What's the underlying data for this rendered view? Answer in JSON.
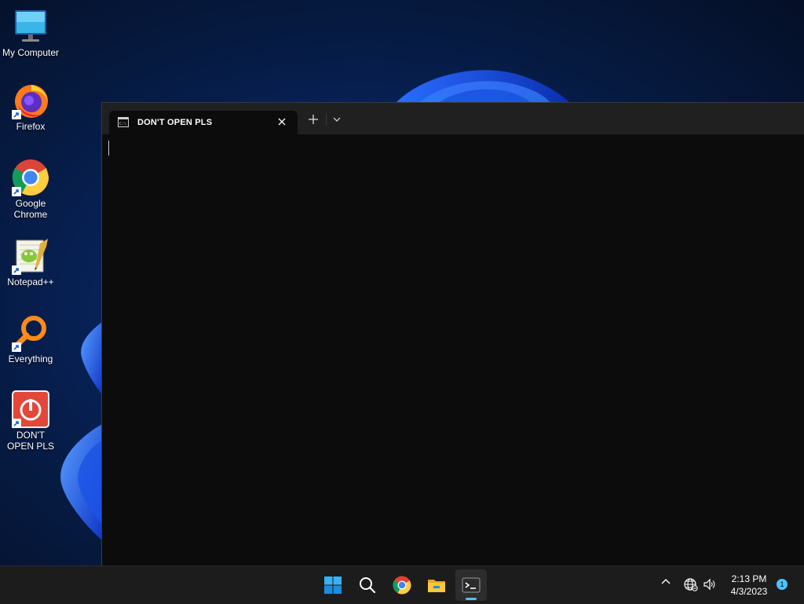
{
  "desktop": {
    "icons": [
      {
        "label": "My Computer",
        "icon": "monitor-icon"
      },
      {
        "label": "Firefox",
        "icon": "firefox-icon"
      },
      {
        "label": "Google Chrome",
        "icon": "chrome-icon"
      },
      {
        "label": "Notepad++",
        "icon": "notepadpp-icon"
      },
      {
        "label": "Everything",
        "icon": "everything-search-icon"
      },
      {
        "label": "DON'T OPEN PLS",
        "icon": "power-icon"
      }
    ]
  },
  "terminal": {
    "tab_title": "DON'T OPEN PLS",
    "tab_icon": "console-icon",
    "close_icon": "close-icon",
    "new_tab_icon": "plus-icon",
    "dropdown_icon": "chevron-down-icon",
    "content": ""
  },
  "taskbar": {
    "apps": [
      {
        "name": "start",
        "icon": "windows-start-icon"
      },
      {
        "name": "search",
        "icon": "search-icon"
      },
      {
        "name": "chrome",
        "icon": "chrome-icon"
      },
      {
        "name": "file-explorer",
        "icon": "folder-icon"
      },
      {
        "name": "terminal",
        "icon": "terminal-icon",
        "active": true
      }
    ],
    "tray": {
      "icons": [
        "chevron-up-icon",
        "network-globe-icon",
        "volume-icon"
      ],
      "time": "2:13 PM",
      "date": "4/3/2023",
      "notification_count": "1"
    }
  },
  "colors": {
    "accent": "#4cc2ff",
    "terminal_bg": "#0c0c0c",
    "titlebar_bg": "#202020",
    "taskbar_bg": "#1c1c1c"
  }
}
